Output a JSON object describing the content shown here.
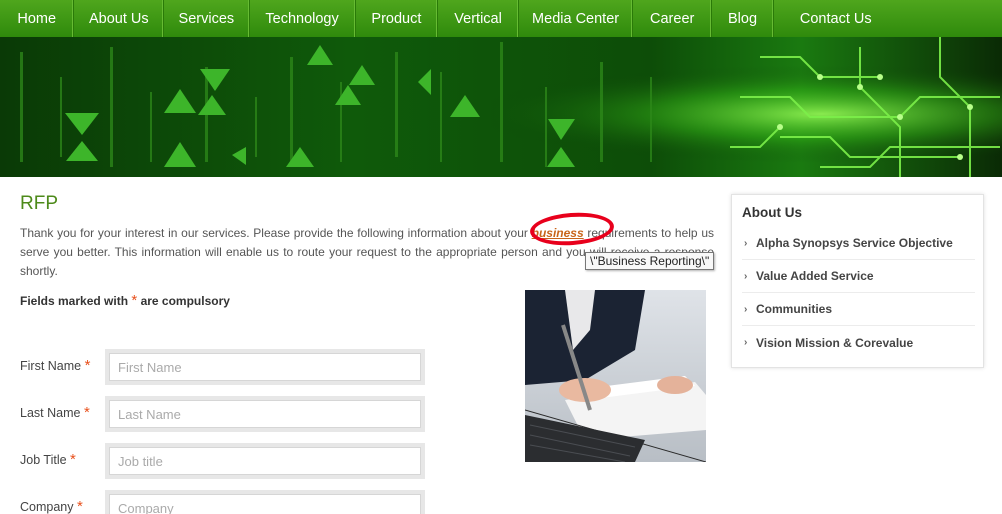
{
  "nav": {
    "items": [
      {
        "label": "Home"
      },
      {
        "label": "About Us"
      },
      {
        "label": "Services"
      },
      {
        "label": "Technology"
      },
      {
        "label": "Product"
      },
      {
        "label": "Vertical"
      },
      {
        "label": "Media Center"
      },
      {
        "label": "Career"
      },
      {
        "label": "Blog"
      },
      {
        "label": "Contact Us"
      }
    ]
  },
  "page": {
    "title": "RFP",
    "intro_before": "Thank you for your interest in our services. Please provide the following information about your ",
    "intro_link": "business",
    "intro_after": " requirements to help us serve you better. This information will enable us to route your request to the appropriate person and you will receive a response shortly.",
    "tooltip": "\\\"Business Reporting\\\"",
    "required_note": {
      "prefix": "Fields marked with",
      "star": "*",
      "suffix": "are compulsory"
    }
  },
  "form": {
    "fields": [
      {
        "label": "First Name",
        "star": "*",
        "placeholder": "First Name",
        "value": ""
      },
      {
        "label": "Last Name",
        "star": "*",
        "placeholder": "Last Name",
        "value": ""
      },
      {
        "label": "Job Title",
        "star": "*",
        "placeholder": "Job title",
        "value": ""
      },
      {
        "label": "Company",
        "star": "*",
        "placeholder": "Company",
        "value": ""
      }
    ]
  },
  "sidebar": {
    "title": "About Us",
    "chevron": "›",
    "items": [
      {
        "label": "Alpha Synopsys Service Objective"
      },
      {
        "label": "Value Added Service"
      },
      {
        "label": "Communities"
      },
      {
        "label": "Vision Mission & Corevalue"
      }
    ]
  },
  "colors": {
    "nav_green": "#3f9a14",
    "title_green": "#4d8a1a",
    "link_orange": "#c8641a",
    "star_orange": "#e8501c",
    "annotation_red": "#e8001c"
  }
}
